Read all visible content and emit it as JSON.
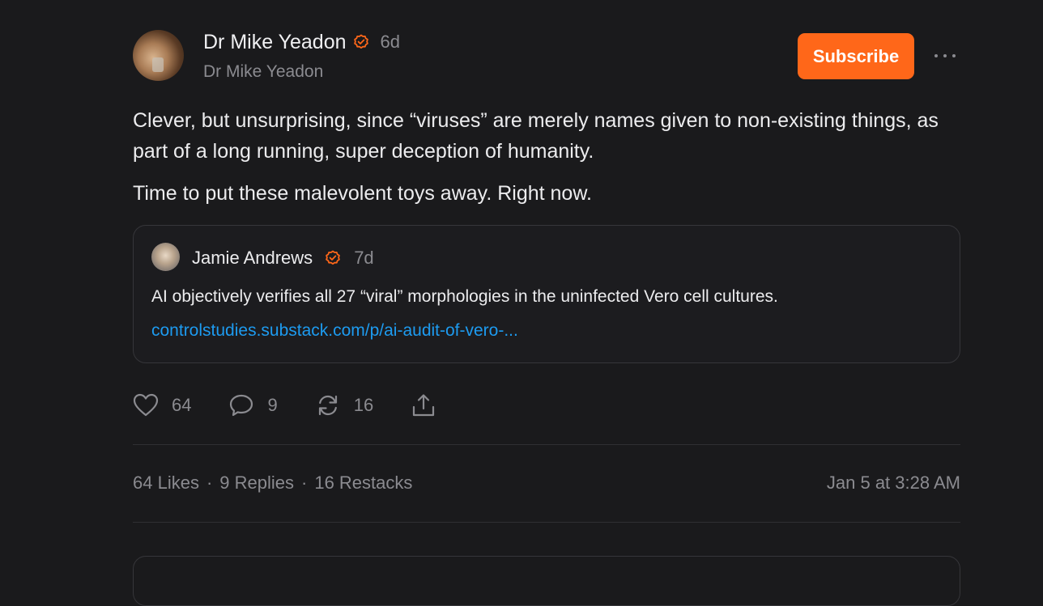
{
  "post": {
    "author_name": "Dr Mike Yeadon",
    "age": "6d",
    "handle": "Dr Mike Yeadon",
    "subscribe_label": "Subscribe",
    "paragraphs": [
      "Clever, but unsurprising, since “viruses” are merely names given to non-existing things, as part of a long running, super deception of humanity.",
      "Time to put these malevolent toys away. Right now."
    ]
  },
  "quote": {
    "author_name": "Jamie Andrews",
    "age": "7d",
    "text": "AI objectively verifies all 27 “viral” morphologies in the uninfected Vero cell cultures.",
    "link": "controlstudies.substack.com/p/ai-audit-of-vero-..."
  },
  "actions": {
    "likes": "64",
    "replies": "9",
    "restacks": "16"
  },
  "stats": {
    "likes": "64 Likes",
    "replies": "9 Replies",
    "restacks": "16 Restacks",
    "separator": "·",
    "timestamp": "Jan 5 at 3:28 AM"
  },
  "colors": {
    "accent": "#ff6719",
    "link": "#1d9bf0",
    "background": "#1a1a1c",
    "muted": "#8b8b90"
  },
  "icons": [
    "verified-badge-icon",
    "more-icon",
    "heart-icon",
    "comment-icon",
    "restack-icon",
    "share-icon"
  ]
}
